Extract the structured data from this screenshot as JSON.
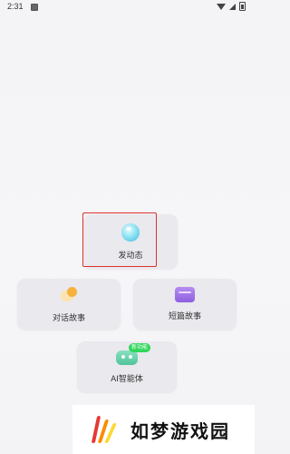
{
  "status_bar": {
    "time": "2:31"
  },
  "cards": {
    "post": {
      "label": "发动态"
    },
    "chat": {
      "label": "对话故事"
    },
    "short": {
      "label": "短篇故事"
    },
    "ai": {
      "label": "AI智能体",
      "badge": "新功能"
    }
  },
  "watermark": {
    "text": "如梦游戏园"
  },
  "colors": {
    "highlight": "#d9322b",
    "card_bg": "#e9e9ee",
    "badge_green": "#2fd65a"
  }
}
